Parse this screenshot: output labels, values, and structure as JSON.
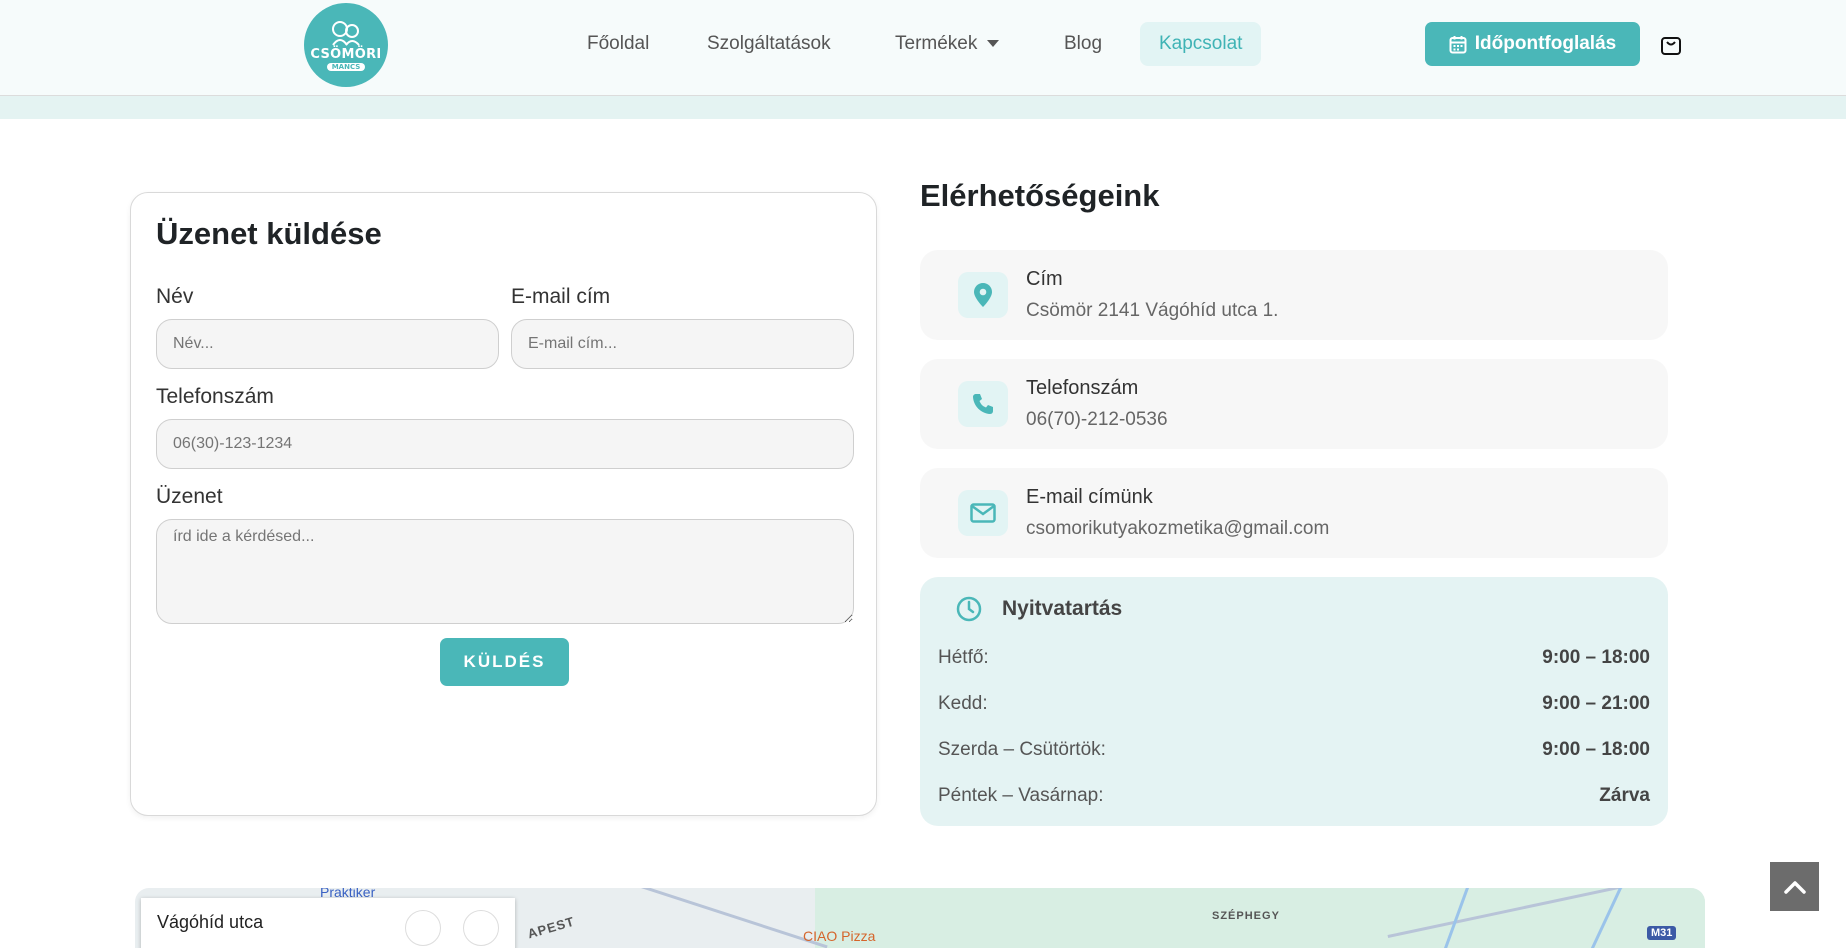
{
  "header": {
    "logo_text": "CSÖMÖRI",
    "logo_sub": "MANCS",
    "nav": [
      {
        "label": "Főoldal"
      },
      {
        "label": "Szolgáltatások"
      },
      {
        "label": "Termékek"
      },
      {
        "label": "Blog"
      },
      {
        "label": "Kapcsolat"
      }
    ],
    "booking_label": "Időpontfoglalás"
  },
  "form": {
    "title": "Üzenet küldése",
    "name_label": "Név",
    "name_placeholder": "Név...",
    "email_label": "E-mail cím",
    "email_placeholder": "E-mail cím...",
    "phone_label": "Telefonszám",
    "phone_placeholder": "06(30)-123-1234",
    "message_label": "Üzenet",
    "message_placeholder": "írd ide a kérdésed...",
    "submit_label": "KÜLDÉS"
  },
  "contact": {
    "title": "Elérhetőségeink",
    "items": [
      {
        "label": "Cím",
        "value": "Csömör 2141 Vágóhíd utca 1.",
        "icon": "location-pin-icon"
      },
      {
        "label": "Telefonszám",
        "value": "06(70)-212-0536",
        "icon": "phone-icon"
      },
      {
        "label": "E-mail címünk",
        "value": "csomorikutyakozmetika@gmail.com",
        "icon": "envelope-icon"
      }
    ]
  },
  "hours": {
    "title": "Nyitvatartás",
    "rows": [
      {
        "day": "Hétfő:",
        "time": "9:00 – 18:00"
      },
      {
        "day": "Kedd:",
        "time": "9:00 – 21:00"
      },
      {
        "day": "Szerda – Csütörtök:",
        "time": "9:00 – 18:00"
      },
      {
        "day": "Péntek – Vasárnap:",
        "time": "Zárva"
      }
    ]
  },
  "map": {
    "panel_title": "Vágóhíd utca",
    "labels": {
      "praktiker": "Praktiker",
      "budapest": "APEST",
      "ciao": "CIAO Pizza",
      "szephegy": "SZÉPHEGY",
      "m31": "M31"
    }
  },
  "colors": {
    "accent": "#4ab7b8",
    "accent_light": "#e2f4f4",
    "header_bg": "#f6fbfb"
  }
}
